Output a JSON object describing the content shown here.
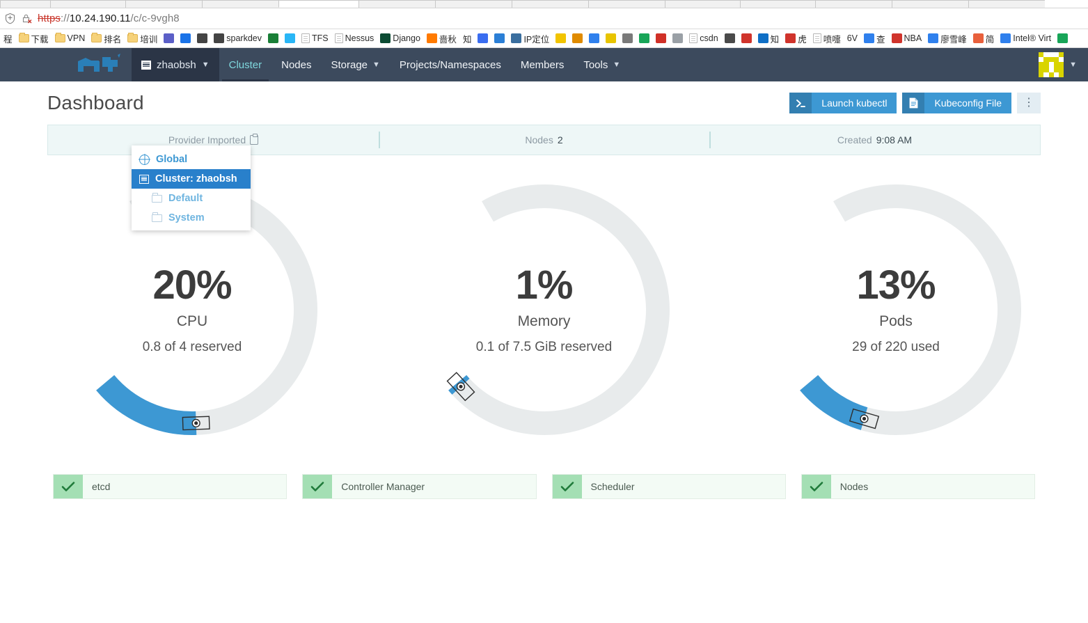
{
  "browser": {
    "url": {
      "scheme": "https",
      "separator": "://",
      "host": "10.24.190.11",
      "path": "/c/c-9vgh8"
    },
    "bookmarks": [
      {
        "label": "程",
        "icon": "none"
      },
      {
        "label": "下载",
        "icon": "folder"
      },
      {
        "label": "VPN",
        "icon": "folder"
      },
      {
        "label": "排名",
        "icon": "folder"
      },
      {
        "label": "培训",
        "icon": "folder"
      },
      {
        "label": "",
        "icon": "teams"
      },
      {
        "label": "",
        "icon": "gs"
      },
      {
        "label": "",
        "icon": "script"
      },
      {
        "label": "sparkdev",
        "icon": "script"
      },
      {
        "label": "",
        "icon": "cn"
      },
      {
        "label": "",
        "icon": "bug"
      },
      {
        "label": "TFS",
        "icon": "page"
      },
      {
        "label": "Nessus",
        "icon": "page"
      },
      {
        "label": "Django",
        "icon": "dj"
      },
      {
        "label": "啬秋",
        "icon": "orange"
      },
      {
        "label": "知",
        "icon": "none"
      },
      {
        "label": "",
        "icon": "diamond"
      },
      {
        "label": "",
        "icon": "e-blue"
      },
      {
        "label": "IP定位",
        "icon": "globe"
      },
      {
        "label": "",
        "icon": "yellow-n"
      },
      {
        "label": "",
        "icon": "u-orange"
      },
      {
        "label": "",
        "icon": "blue-dot"
      },
      {
        "label": "",
        "icon": "yellow-o"
      },
      {
        "label": "",
        "icon": "gray-s"
      },
      {
        "label": "",
        "icon": "c-green"
      },
      {
        "label": "",
        "icon": "red-o"
      },
      {
        "label": "",
        "icon": "pen"
      },
      {
        "label": "csdn",
        "icon": "page"
      },
      {
        "label": "",
        "icon": "info"
      },
      {
        "label": "",
        "icon": "z-red"
      },
      {
        "label": "知",
        "icon": "zhi-blue"
      },
      {
        "label": "虎",
        "icon": "hu-red"
      },
      {
        "label": "喷嚏",
        "icon": "page"
      },
      {
        "label": "6V",
        "icon": "none"
      },
      {
        "label": "查",
        "icon": "cha"
      },
      {
        "label": "NBA",
        "icon": "nba"
      },
      {
        "label": "廖雪峰",
        "icon": "liao"
      },
      {
        "label": "简",
        "icon": "jian"
      },
      {
        "label": "Intel® Virt",
        "icon": "intel"
      },
      {
        "label": "",
        "icon": "g-green"
      }
    ]
  },
  "nav": {
    "cluster_selector": "zhaobsh",
    "items": [
      {
        "label": "Cluster",
        "active": true,
        "caret": false
      },
      {
        "label": "Nodes",
        "active": false,
        "caret": false
      },
      {
        "label": "Storage",
        "active": false,
        "caret": true
      },
      {
        "label": "Projects/Namespaces",
        "active": false,
        "caret": false
      },
      {
        "label": "Members",
        "active": false,
        "caret": false
      },
      {
        "label": "Tools",
        "active": false,
        "caret": true
      }
    ]
  },
  "dropdown": {
    "items": [
      {
        "label": "Global",
        "icon": "globe-icon",
        "selected": false,
        "sub": false
      },
      {
        "label": "Cluster: zhaobsh",
        "icon": "list-icon",
        "selected": true,
        "sub": false
      },
      {
        "label": "Default",
        "icon": "folder-icon",
        "selected": false,
        "sub": true
      },
      {
        "label": "System",
        "icon": "folder-icon",
        "selected": false,
        "sub": true
      }
    ]
  },
  "header": {
    "title": "Dashboard",
    "launch_kubectl": "Launch kubectl",
    "kubeconfig_file": "Kubeconfig File",
    "kebab": "⋮"
  },
  "banner": [
    {
      "label": "Provider Imported",
      "value": "",
      "icon": "clipboard-icon"
    },
    {
      "label": "Nodes",
      "value": "2",
      "icon": ""
    },
    {
      "label": "Created",
      "value": "9:08 AM",
      "icon": ""
    }
  ],
  "chart_data": [
    {
      "type": "gauge",
      "title": "CPU",
      "percent": 20,
      "value_text": "20%",
      "subtitle": "0.8 of 4 reserved",
      "used": 0.8,
      "total": 4,
      "unit": "cores",
      "range": [
        0,
        100
      ],
      "arc_color": "#3d98d3",
      "track_color": "#e8ebec"
    },
    {
      "type": "gauge",
      "title": "Memory",
      "percent": 1,
      "value_text": "1%",
      "subtitle": "0.1 of 7.5 GiB reserved",
      "used": 0.1,
      "total": 7.5,
      "unit": "GiB",
      "range": [
        0,
        100
      ],
      "arc_color": "#3d98d3",
      "track_color": "#e8ebec"
    },
    {
      "type": "gauge",
      "title": "Pods",
      "percent": 13,
      "value_text": "13%",
      "subtitle": "29 of 220 used",
      "used": 29,
      "total": 220,
      "unit": "pods",
      "range": [
        0,
        100
      ],
      "arc_color": "#3d98d3",
      "track_color": "#e8ebec"
    }
  ],
  "health": [
    {
      "label": "etcd",
      "status": "ok",
      "icon": "check-icon"
    },
    {
      "label": "Controller Manager",
      "status": "ok",
      "icon": "check-icon"
    },
    {
      "label": "Scheduler",
      "status": "ok",
      "icon": "check-icon"
    },
    {
      "label": "Nodes",
      "status": "ok",
      "icon": "check-icon"
    }
  ],
  "colors": {
    "accent": "#3d98d3",
    "nav_bg": "#3c4a5d",
    "nav_picker_bg": "#2b3546",
    "nav_active": "#7fd8de",
    "banner_bg": "#eef7f7",
    "health_ok": "#a4dfb4",
    "gauge_fill": "#3d98d3",
    "gauge_track": "#e8ebec",
    "avatar": "#d9d400"
  }
}
